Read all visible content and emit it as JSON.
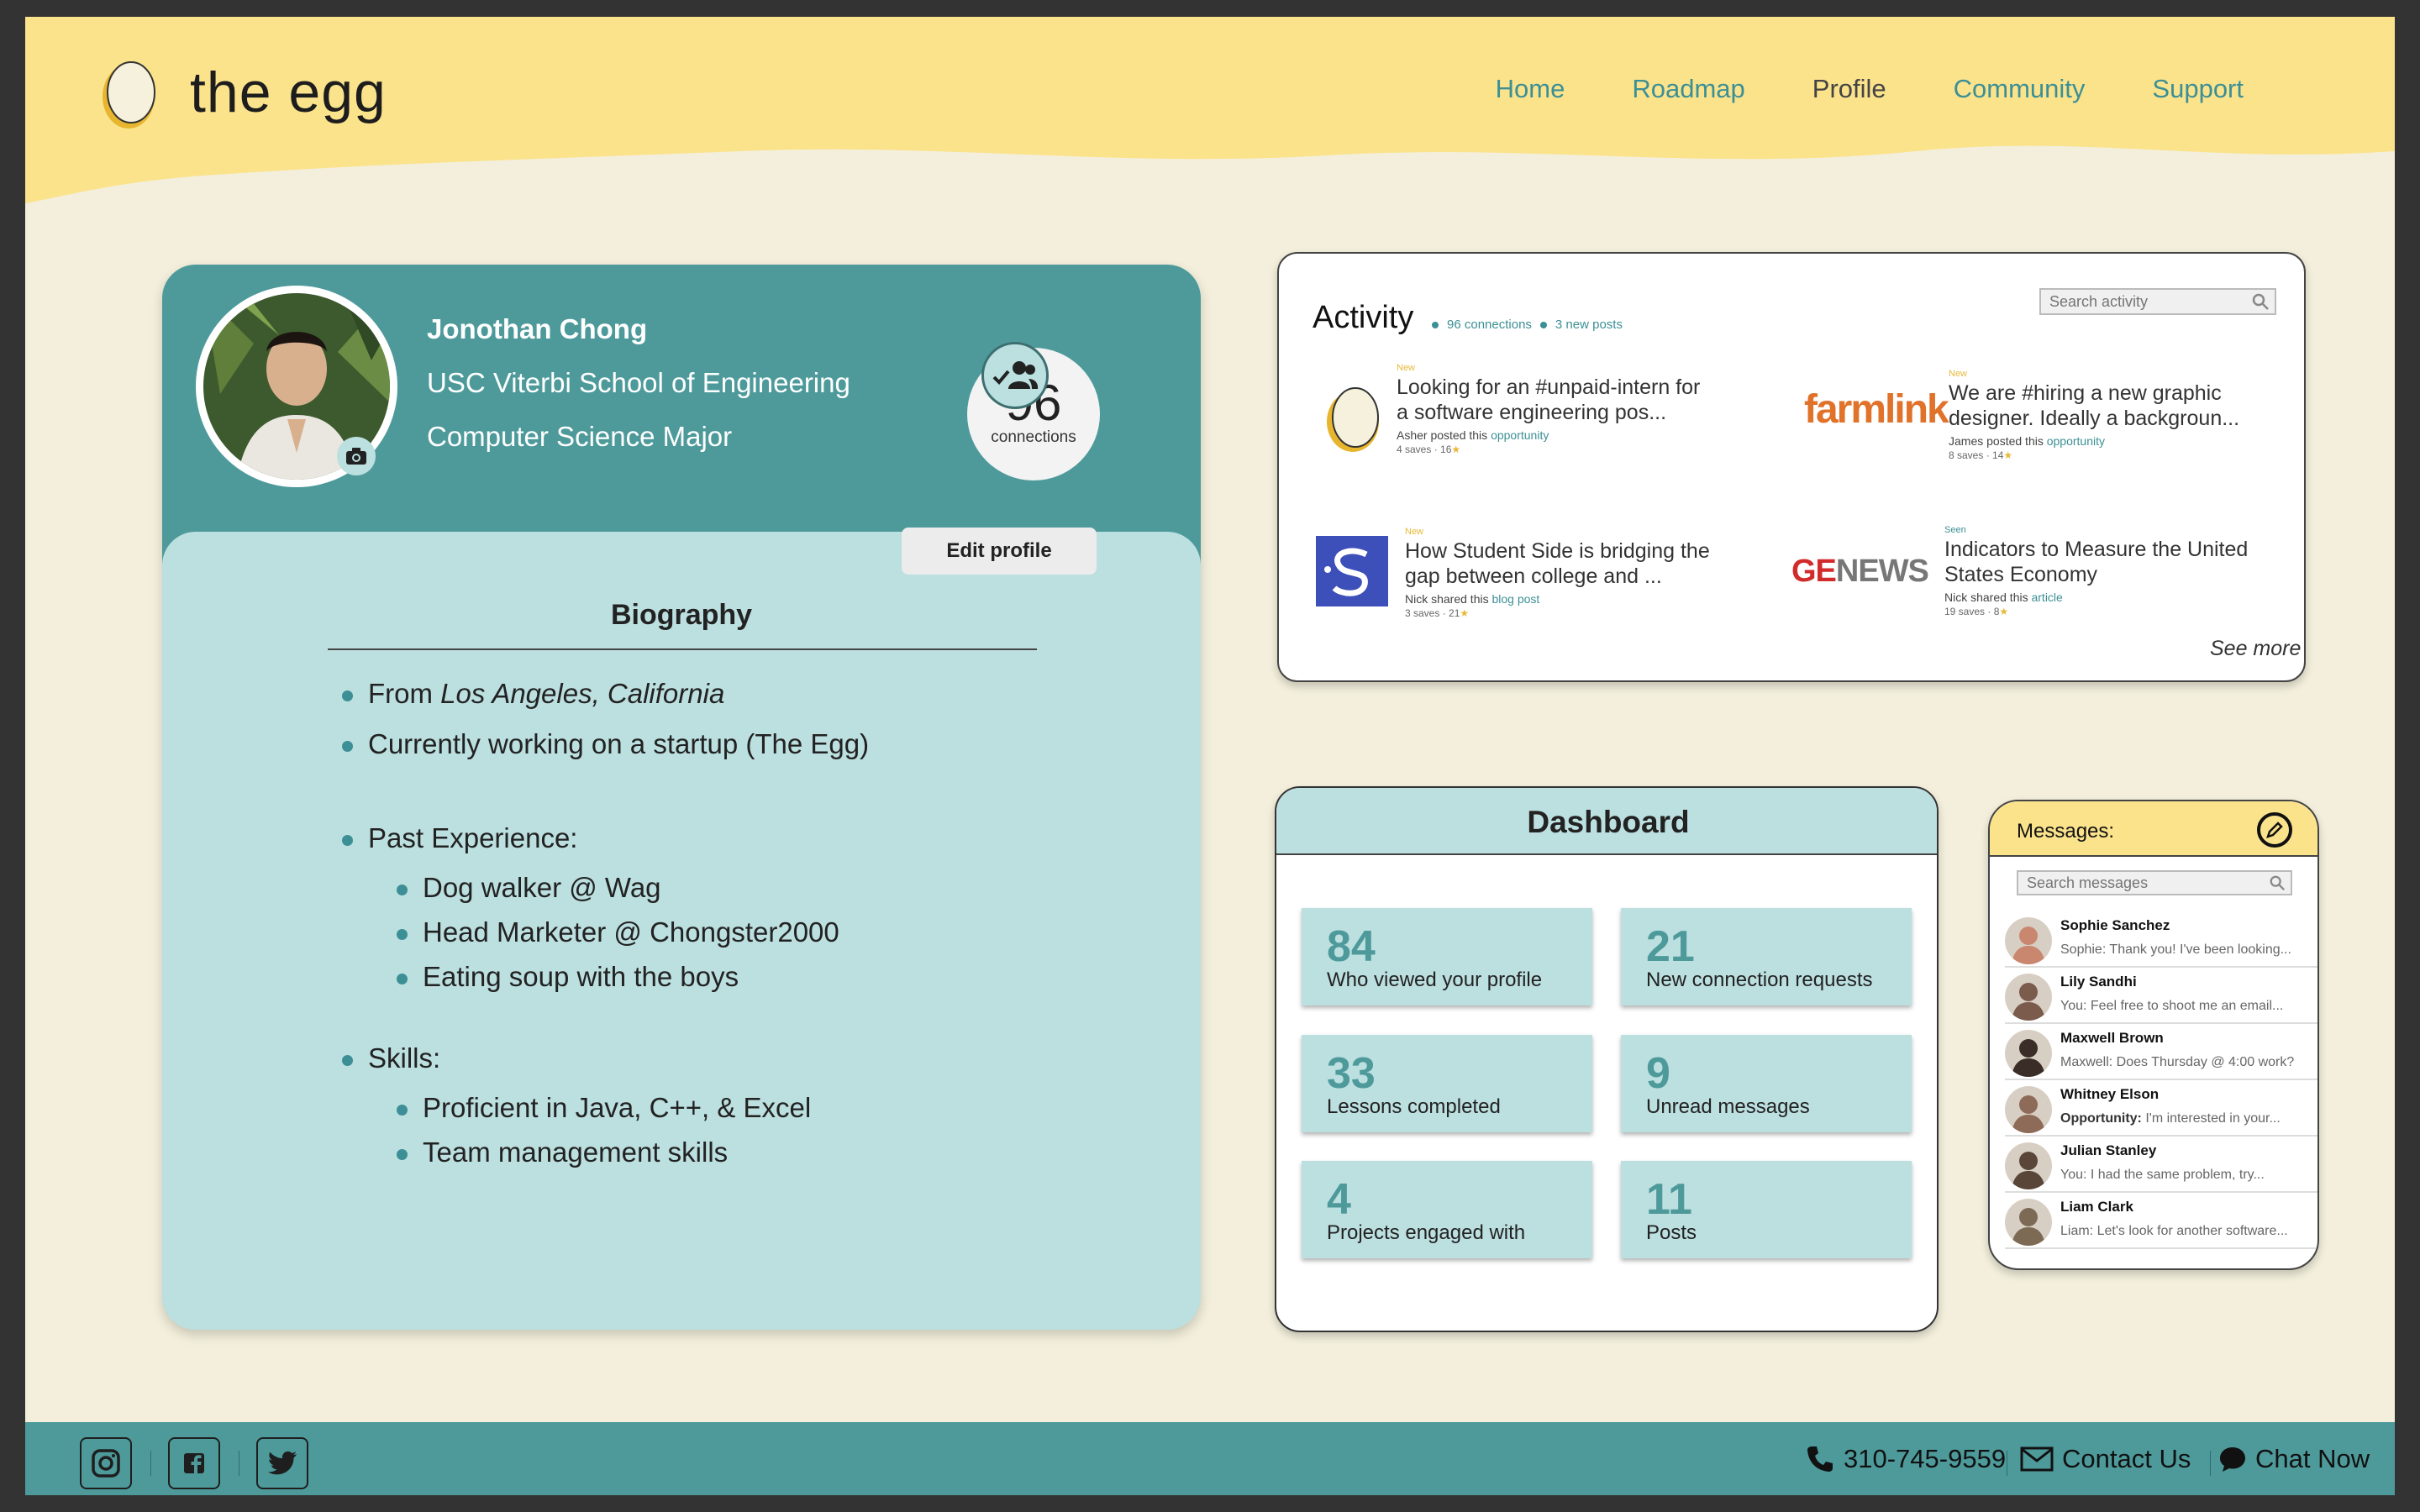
{
  "brand": {
    "name": "the egg"
  },
  "nav": {
    "home": "Home",
    "roadmap": "Roadmap",
    "profile": "Profile",
    "community": "Community",
    "support": "Support",
    "active": "Profile"
  },
  "profile": {
    "name": "Jonothan Chong",
    "school": "USC Viterbi School of Engineering",
    "major": "Computer Science Major",
    "connections_count": "96",
    "connections_label": "connections",
    "edit_label": "Edit profile"
  },
  "bio": {
    "title": "Biography",
    "from_prefix": "From ",
    "from_place": "Los Angeles, California",
    "current": "Currently working on a startup (The Egg)",
    "past_heading": "Past Experience:",
    "past": [
      "Dog walker @ Wag",
      "Head Marketer @ Chongster2000",
      "Eating soup with the boys"
    ],
    "skills_heading": "Skills:",
    "skills": [
      "Proficient in Java, C++, & Excel",
      "Team management skills"
    ]
  },
  "activity": {
    "title": "Activity",
    "connections": "96 connections",
    "new_posts": "3 new posts",
    "search_placeholder": "Search activity",
    "see_more": "See more",
    "posts": [
      {
        "tag": "New",
        "text": "Looking for an #unpaid-intern for a software engineering pos...",
        "author": "Asher posted this ",
        "link": "opportunity",
        "stats": "4 saves · 16",
        "star": "★",
        "logo": "egg-logo"
      },
      {
        "tag": "New",
        "text": "We are #hiring a new graphic designer. Ideally a backgroun...",
        "author": "James posted this ",
        "link": "opportunity",
        "stats": "8 saves · 14",
        "star": "★",
        "logo": "farmlink-logo",
        "logo_text": "farmlink"
      },
      {
        "tag": "New",
        "text": "How Student Side is bridging the gap between college and ...",
        "author": "Nick shared this ",
        "link": "blog post",
        "stats": "3 saves · 21",
        "star": "★",
        "logo": "studentside-logo"
      },
      {
        "tag": "Seen",
        "text": "Indicators to Measure the United States Economy",
        "author": "Nick shared this ",
        "link": "article",
        "stats": "19 saves · 8",
        "star": "★",
        "logo": "genews-logo",
        "logo_text_a": "GE",
        "logo_text_b": "NEWS"
      }
    ]
  },
  "dashboard": {
    "title": "Dashboard",
    "tiles": [
      {
        "value": "84",
        "label": "Who viewed your profile"
      },
      {
        "value": "21",
        "label": "New connection requests"
      },
      {
        "value": "33",
        "label": "Lessons completed"
      },
      {
        "value": "9",
        "label": "Unread messages"
      },
      {
        "value": "4",
        "label": "Projects engaged with"
      },
      {
        "value": "11",
        "label": "Posts"
      }
    ]
  },
  "messages": {
    "title": "Messages:",
    "search_placeholder": "Search messages",
    "items": [
      {
        "name": "Sophie Sanchez",
        "preview": "Sophie: Thank you! I've been looking...",
        "color": "#c9876f"
      },
      {
        "name": "Lily Sandhi",
        "preview": "You: Feel free to shoot me an email...",
        "color": "#7a5b4c"
      },
      {
        "name": "Maxwell Brown",
        "preview": "Maxwell: Does Thursday @ 4:00 work?",
        "color": "#3a2c26"
      },
      {
        "name": "Whitney Elson",
        "preview_bold": "Opportunity:",
        "preview": " I'm interested in your...",
        "color": "#8e6a58"
      },
      {
        "name": "Julian Stanley",
        "preview": "You: I had the same problem, try...",
        "color": "#5a4638"
      },
      {
        "name": "Liam Clark",
        "preview": "Liam: Let's look for another software...",
        "color": "#7d6a55"
      }
    ]
  },
  "footer": {
    "phone": "310-745-9559",
    "contact": "Contact Us",
    "chat": "Chat Now",
    "social": [
      "instagram-icon",
      "facebook-icon",
      "twitter-icon"
    ]
  },
  "colors": {
    "teal": "#4e9a9b",
    "light_teal": "#bcdfe0",
    "yellow": "#fbe38c",
    "cream": "#f3efdc"
  }
}
